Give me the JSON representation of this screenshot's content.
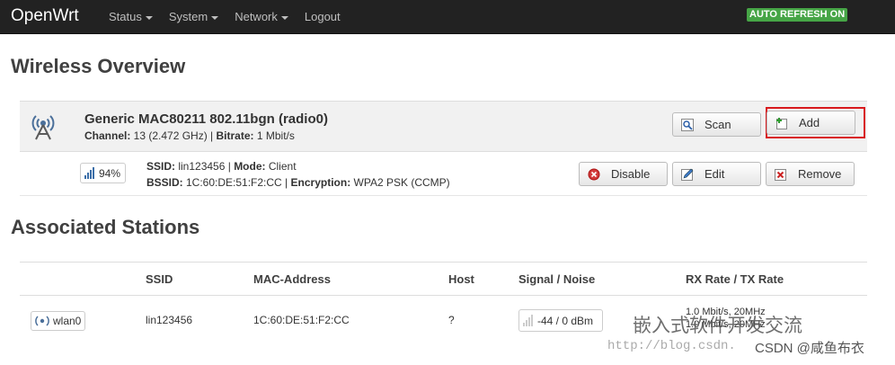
{
  "navbar": {
    "brand": "OpenWrt",
    "menu": [
      {
        "label": "Status",
        "dropdown": true
      },
      {
        "label": "System",
        "dropdown": true
      },
      {
        "label": "Network",
        "dropdown": true
      },
      {
        "label": "Logout",
        "dropdown": false
      }
    ],
    "auto_refresh": "AUTO REFRESH ON"
  },
  "overview": {
    "title": "Wireless Overview",
    "radio": {
      "icon": "wifi-radio-icon",
      "name": "Generic MAC80211 802.11bgn (radio0)",
      "channel_label": "Channel:",
      "channel_value": " 13 (2.472 GHz) | ",
      "bitrate_label": "Bitrate:",
      "bitrate_value": " 1 Mbit/s",
      "scan_button": "Scan",
      "add_button": "Add"
    },
    "network": {
      "signal_percent": "94%",
      "ssid_label": "SSID:",
      "ssid_value": " lin123456 | ",
      "mode_label": "Mode:",
      "mode_value": " Client",
      "bssid_label": "BSSID:",
      "bssid_value": " 1C:60:DE:51:F2:CC | ",
      "encryption_label": "Encryption:",
      "encryption_value": " WPA2 PSK (CCMP)",
      "disable_button": "Disable",
      "edit_button": "Edit",
      "remove_button": "Remove"
    }
  },
  "stations": {
    "title": "Associated Stations",
    "columns": [
      "SSID",
      "MAC-Address",
      "Host",
      "Signal / Noise",
      "RX Rate / TX Rate"
    ],
    "rows": [
      {
        "iface": "wlan0",
        "ssid": "lin123456",
        "mac": "1C:60:DE:51:F2:CC",
        "host": "?",
        "signal_noise": "-44 / 0 dBm",
        "rx_rate": "1.0 Mbit/s, 20MHz",
        "tx_rate": "1.0 Mbit/s, 20MHz"
      }
    ]
  },
  "watermark": {
    "text": "嵌入式软件开发交流",
    "url": "http://blog.csdn.",
    "csdn": "CSDN @咸鱼布衣"
  },
  "colors": {
    "navbar_bg": "#222222",
    "auto_refresh_bg": "#46a546",
    "highlight_border": "#d8191d"
  }
}
